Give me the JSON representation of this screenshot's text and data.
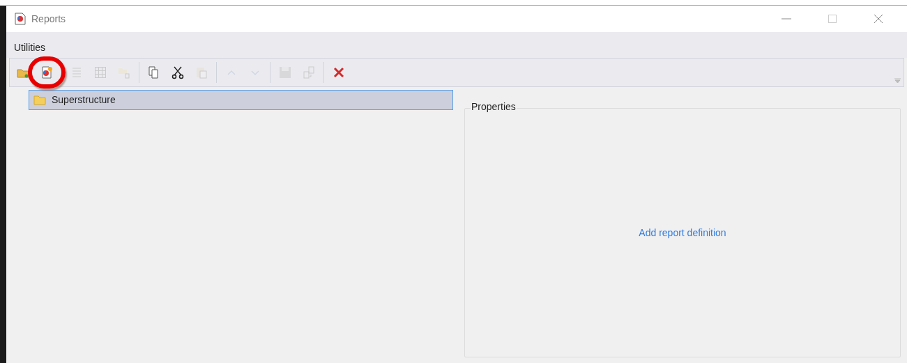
{
  "window": {
    "title": "Reports"
  },
  "menu": [
    {
      "label": "Utilities"
    }
  ],
  "toolbar": [
    [
      {
        "kind": "open",
        "disabled": false
      },
      {
        "kind": "new-report",
        "disabled": false,
        "highlighted": true
      }
    ],
    [
      {
        "kind": "list",
        "disabled": true
      },
      {
        "kind": "grid",
        "disabled": true
      },
      {
        "kind": "move",
        "disabled": true
      }
    ],
    [
      {
        "kind": "copy",
        "disabled": false
      },
      {
        "kind": "cut",
        "disabled": false
      },
      {
        "kind": "paste",
        "disabled": true
      }
    ],
    [
      {
        "kind": "up",
        "disabled": true
      },
      {
        "kind": "down",
        "disabled": true
      }
    ],
    [
      {
        "kind": "save",
        "disabled": true
      },
      {
        "kind": "export",
        "disabled": true
      }
    ],
    [
      {
        "kind": "delete",
        "disabled": false
      }
    ]
  ],
  "tree": [
    {
      "label": "Superstructure",
      "selected": true
    }
  ],
  "properties": {
    "title": "Properties",
    "link": "Add report definition"
  }
}
